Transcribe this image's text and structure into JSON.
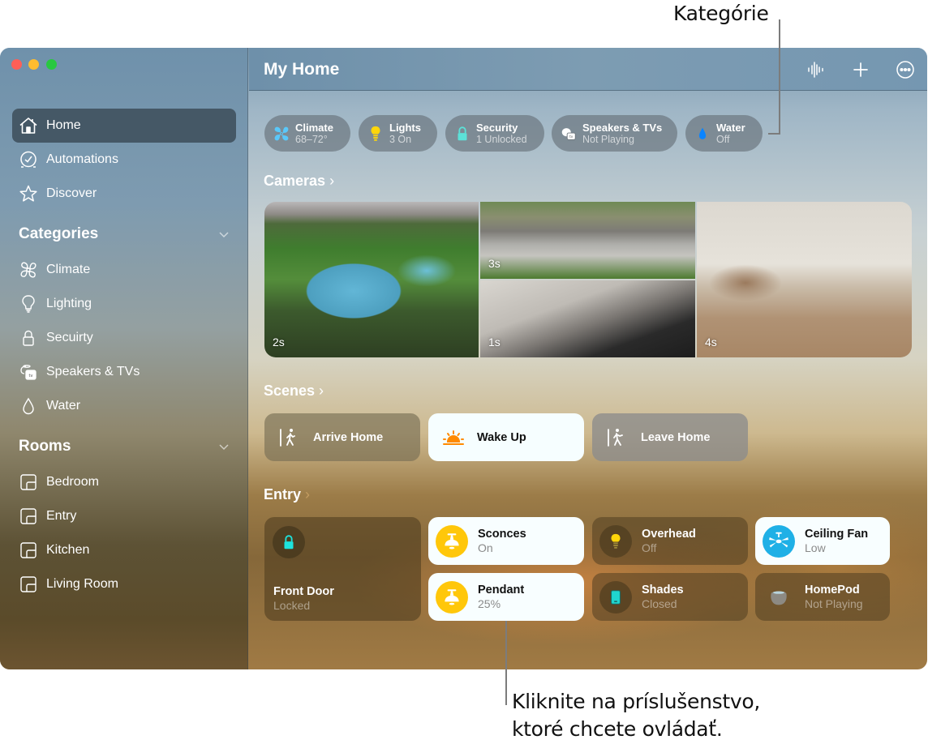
{
  "callouts": {
    "categories": "Kategórie",
    "accessory_line1": "Kliknite na príslušenstvo,",
    "accessory_line2": "ktoré chcete ovládať."
  },
  "window": {
    "title": "My Home",
    "toolbar": [
      {
        "icon": "waveform-icon",
        "label": "Intercom"
      },
      {
        "icon": "plus-icon",
        "label": "Add"
      },
      {
        "icon": "more-icon",
        "label": "More"
      }
    ]
  },
  "sidebar": {
    "nav": [
      {
        "label": "Home",
        "icon": "house-icon",
        "active": true
      },
      {
        "label": "Automations",
        "icon": "clock-icon",
        "active": false
      },
      {
        "label": "Discover",
        "icon": "star-icon",
        "active": false
      }
    ],
    "categories_heading": "Categories",
    "categories": [
      {
        "label": "Climate",
        "icon": "fan-icon"
      },
      {
        "label": "Lighting",
        "icon": "lightbulb-icon"
      },
      {
        "label": "Secuirty",
        "icon": "lock-icon"
      },
      {
        "label": "Speakers & TVs",
        "icon": "homepod-appletv-icon"
      },
      {
        "label": "Water",
        "icon": "drop-icon"
      }
    ],
    "rooms_heading": "Rooms",
    "rooms": [
      {
        "label": "Bedroom",
        "icon": "room-icon"
      },
      {
        "label": "Entry",
        "icon": "room-icon"
      },
      {
        "label": "Kitchen",
        "icon": "room-icon"
      },
      {
        "label": "Living Room",
        "icon": "room-icon"
      }
    ]
  },
  "status_pills": [
    {
      "name": "Climate",
      "status": "68–72°",
      "icon": "fan-icon",
      "color": "#5ac8fa"
    },
    {
      "name": "Lights",
      "status": "3 On",
      "icon": "lightbulb-icon",
      "color": "#ffd60a"
    },
    {
      "name": "Security",
      "status": "1 Unlocked",
      "icon": "lock-icon",
      "color": "#5ce1d8"
    },
    {
      "name": "Speakers & TVs",
      "status": "Not Playing",
      "icon": "homepod-appletv-icon",
      "color": "#ffffff"
    },
    {
      "name": "Water",
      "status": "Off",
      "icon": "drop-icon",
      "color": "#0a84ff"
    }
  ],
  "cameras": {
    "heading": "Cameras",
    "feeds": [
      {
        "name": "Backyard pool",
        "age": "2s"
      },
      {
        "name": "Front driveway",
        "age": "3s"
      },
      {
        "name": "Garage",
        "age": "1s"
      },
      {
        "name": "Living room",
        "age": "4s"
      }
    ]
  },
  "scenes": {
    "heading": "Scenes",
    "items": [
      {
        "label": "Arrive Home",
        "icon": "arrive-home-icon",
        "active": false
      },
      {
        "label": "Wake Up",
        "icon": "sunrise-icon",
        "active": true
      },
      {
        "label": "Leave Home",
        "icon": "leave-home-icon",
        "active": false
      }
    ]
  },
  "entry": {
    "heading": "Entry",
    "front_door": {
      "name": "Front Door",
      "status": "Locked",
      "icon": "lock-icon"
    },
    "accessories": [
      {
        "name": "Sconces",
        "status": "On",
        "icon": "pendant-lamp-icon",
        "on": true
      },
      {
        "name": "Overhead",
        "status": "Off",
        "icon": "lightbulb-icon",
        "on": false
      },
      {
        "name": "Ceiling Fan",
        "status": "Low",
        "icon": "ceiling-fan-icon",
        "on": true
      },
      {
        "name": "Pendant",
        "status": "25%",
        "icon": "pendant-lamp-icon",
        "on": true
      },
      {
        "name": "Shades",
        "status": "Closed",
        "icon": "shades-icon",
        "on": false
      },
      {
        "name": "HomePod",
        "status": "Not Playing",
        "icon": "homepod-icon",
        "on": false
      }
    ]
  },
  "colors": {
    "light_on": "#ffc70a",
    "fan_on": "#1fb0e6",
    "lock_teal": "#1de3dd",
    "sunrise_orange": "#ff8a00"
  }
}
